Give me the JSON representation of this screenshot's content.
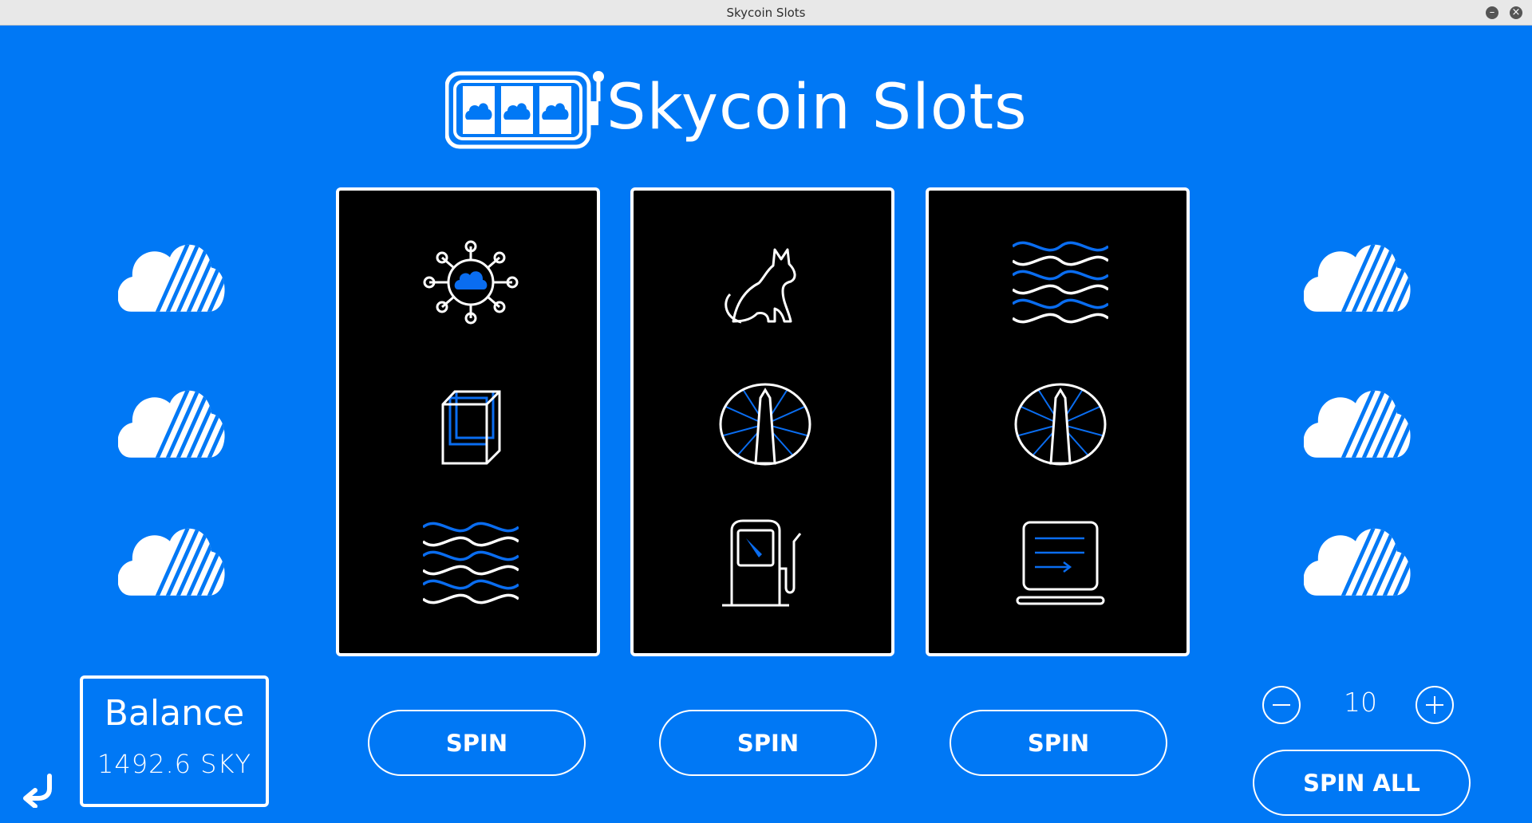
{
  "window": {
    "title": "Skycoin Slots"
  },
  "logo": {
    "text": "Skycoin Slots"
  },
  "reels": [
    {
      "symbols": [
        "network-icon",
        "cube-icon",
        "waves-icon"
      ]
    },
    {
      "symbols": [
        "cat-icon",
        "obelisk-icon",
        "fuel-pump-icon"
      ]
    },
    {
      "symbols": [
        "waves-icon",
        "obelisk-icon",
        "terminal-icon"
      ]
    }
  ],
  "buttons": {
    "spin": "SPIN",
    "spin_all": "SPIN ALL"
  },
  "balance": {
    "label": "Balance",
    "amount": "1492.6 SKY"
  },
  "bet": {
    "value": "10"
  },
  "colors": {
    "background": "#0078f5",
    "accent_blue": "#0a6df0",
    "reel_bg": "#000000"
  }
}
